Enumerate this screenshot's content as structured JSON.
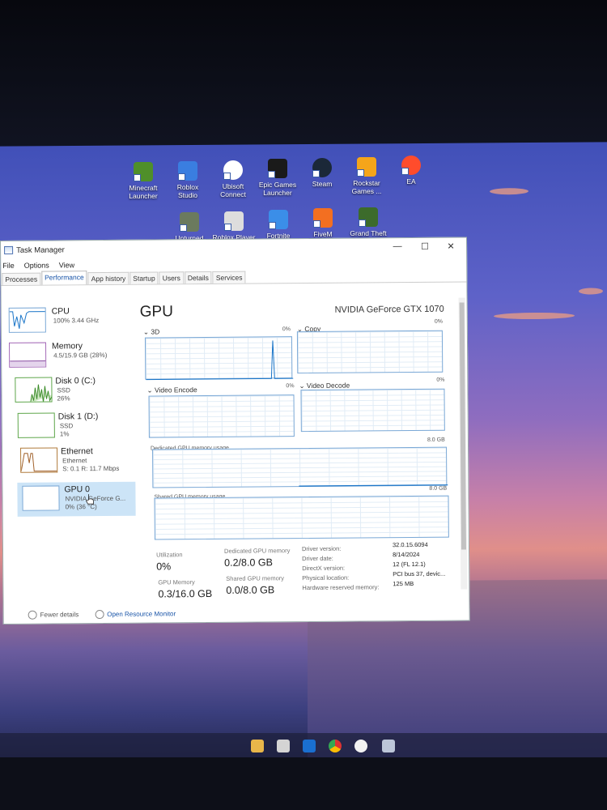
{
  "desktop": {
    "icons_row1": [
      {
        "label": "Minecraft\nLauncher",
        "icon": "minecraft-icon",
        "color": "#4f8f2a"
      },
      {
        "label": "Roblox\nStudio",
        "icon": "roblox-studio-icon",
        "color": "#3a7ee0"
      },
      {
        "label": "Ubisoft\nConnect",
        "icon": "ubisoft-icon",
        "color": "#ffffff"
      },
      {
        "label": "Epic Games\nLauncher",
        "icon": "epic-games-icon",
        "color": "#1a1a1a"
      },
      {
        "label": "Steam",
        "icon": "steam-icon",
        "color": "#1b2838"
      },
      {
        "label": "Rockstar\nGames ...",
        "icon": "rockstar-icon",
        "color": "#f5a51a"
      },
      {
        "label": "EA",
        "icon": "ea-icon",
        "color": "#ff4c2c"
      }
    ],
    "icons_row2": [
      {
        "label": "Unturned",
        "icon": "unturned-icon",
        "color": "#6b7a5e"
      },
      {
        "label": "Roblox Player",
        "icon": "roblox-player-icon",
        "color": "#dddddd"
      },
      {
        "label": "Fortnite",
        "icon": "fortnite-icon",
        "color": "#3b8ee8"
      },
      {
        "label": "FiveM",
        "icon": "fivem-icon",
        "color": "#f36f21"
      },
      {
        "label": "Grand Theft\nAuto V",
        "icon": "gta-v-icon",
        "color": "#3c6b2b"
      }
    ]
  },
  "window": {
    "title": "Task Manager",
    "menu": [
      "File",
      "Options",
      "View"
    ],
    "tabs": [
      "Processes",
      "Performance",
      "App history",
      "Startup",
      "Users",
      "Details",
      "Services"
    ],
    "active_tab": "Performance",
    "controls": {
      "minimize": "—",
      "maximize": "☐",
      "close": "✕"
    }
  },
  "sidebar": {
    "items": [
      {
        "name": "CPU",
        "sub1": "100% 3.44 GHz",
        "sub2": "",
        "sub3": ""
      },
      {
        "name": "Memory",
        "sub1": "4.5/15.9 GB (28%)",
        "sub2": "",
        "sub3": ""
      },
      {
        "name": "Disk 0 (C:)",
        "sub1": "SSD",
        "sub2": "26%",
        "sub3": ""
      },
      {
        "name": "Disk 1 (D:)",
        "sub1": "SSD",
        "sub2": "1%",
        "sub3": ""
      },
      {
        "name": "Ethernet",
        "sub1": "Ethernet",
        "sub2": "S: 0.1 R: 11.7 Mbps",
        "sub3": ""
      },
      {
        "name": "GPU 0",
        "sub1": "NVIDIA GeForce G...",
        "sub2": "0% (36 °C)",
        "sub3": ""
      }
    ],
    "selected": "GPU 0"
  },
  "gpu": {
    "title": "GPU",
    "model": "NVIDIA GeForce GTX 1070",
    "engines": [
      {
        "label": "3D",
        "pct": "0%"
      },
      {
        "label": "Copy",
        "pct": "0%"
      },
      {
        "label": "Video Encode",
        "pct": "0%"
      },
      {
        "label": "Video Decode",
        "pct": "0%"
      }
    ],
    "dedicated_label": "Dedicated GPU memory usage",
    "dedicated_max": "8.0 GB",
    "shared_label": "Shared GPU memory usage",
    "shared_max": "8.0 GB",
    "stats": {
      "utilization_label": "Utilization",
      "utilization": "0%",
      "dedicated_label": "Dedicated GPU memory",
      "dedicated": "0.2/8.0 GB",
      "gpu_memory_label": "GPU Memory",
      "gpu_memory": "0.3/16.0 GB",
      "shared_label": "Shared GPU memory",
      "shared": "0.0/8.0 GB"
    },
    "details": [
      {
        "k": "Driver version:",
        "v": "32.0.15.6094"
      },
      {
        "k": "Driver date:",
        "v": "8/14/2024"
      },
      {
        "k": "DirectX version:",
        "v": "12 (FL 12.1)"
      },
      {
        "k": "Physical location:",
        "v": "PCI bus 37, devic..."
      },
      {
        "k": "Hardware reserved memory:",
        "v": "125 MB"
      }
    ]
  },
  "footer": {
    "fewer": "Fewer details",
    "monitor": "Open Resource Monitor"
  }
}
